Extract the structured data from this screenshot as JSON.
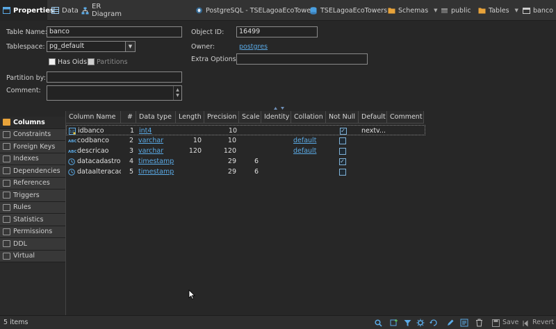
{
  "tabs": [
    {
      "label": "Properties",
      "icon": "properties-icon",
      "active": true
    },
    {
      "label": "Data",
      "icon": "data-grid-icon",
      "active": false
    },
    {
      "label": "ER Diagram",
      "icon": "er-diagram-icon",
      "active": false
    }
  ],
  "breadcrumb": {
    "connection": "PostgreSQL - TSELagoaEcoTowers",
    "database": "TSELagoaEcoTowers",
    "schemas": "Schemas",
    "schema": "public",
    "tables": "Tables",
    "table": "banco"
  },
  "form": {
    "table_name_label": "Table Name:",
    "table_name_value": "banco",
    "tablespace_label": "Tablespace:",
    "tablespace_value": "pg_default",
    "has_oids_label": "Has Oids",
    "partitions_label": "Partitions",
    "object_id_label": "Object ID:",
    "object_id_value": "16499",
    "owner_label": "Owner:",
    "owner_value": "postgres",
    "extra_options_label": "Extra Options:",
    "extra_options_value": "",
    "partition_by_label": "Partition by:",
    "partition_by_value": "",
    "comment_label": "Comment:",
    "comment_value": ""
  },
  "nav": {
    "items": [
      {
        "label": "Columns",
        "icon": "columns-icon",
        "active": true
      },
      {
        "label": "Constraints",
        "icon": "constraints-icon"
      },
      {
        "label": "Foreign Keys",
        "icon": "foreign-keys-icon"
      },
      {
        "label": "Indexes",
        "icon": "indexes-icon"
      },
      {
        "label": "Dependencies",
        "icon": "dependencies-icon"
      },
      {
        "label": "References",
        "icon": "references-icon"
      },
      {
        "label": "Triggers",
        "icon": "triggers-icon"
      },
      {
        "label": "Rules",
        "icon": "rules-icon"
      },
      {
        "label": "Statistics",
        "icon": "statistics-icon"
      },
      {
        "label": "Permissions",
        "icon": "permissions-icon"
      },
      {
        "label": "DDL",
        "icon": "ddl-icon"
      },
      {
        "label": "Virtual",
        "icon": "virtual-icon"
      }
    ]
  },
  "grid": {
    "headers": [
      "Column Name",
      "#",
      "Data type",
      "Length",
      "Precision",
      "Scale",
      "Identity",
      "Collation",
      "Not Null",
      "Default",
      "Comment"
    ],
    "rows": [
      {
        "name": "idbanco",
        "num": "1",
        "type": "int4",
        "length": "",
        "precision": "10",
        "scale": "",
        "identity": "",
        "collation": "",
        "notnull": true,
        "default": "nextv...",
        "comment": "",
        "icon": "key-column-icon"
      },
      {
        "name": "codbanco",
        "num": "2",
        "type": "varchar",
        "length": "10",
        "precision": "10",
        "scale": "",
        "identity": "",
        "collation": "default",
        "notnull": false,
        "default": "",
        "comment": "",
        "icon": "text-column-icon"
      },
      {
        "name": "descricao",
        "num": "3",
        "type": "varchar",
        "length": "120",
        "precision": "120",
        "scale": "",
        "identity": "",
        "collation": "default",
        "notnull": false,
        "default": "",
        "comment": "",
        "icon": "text-column-icon"
      },
      {
        "name": "datacadastro",
        "num": "4",
        "type": "timestamp",
        "length": "",
        "precision": "29",
        "scale": "6",
        "identity": "",
        "collation": "",
        "notnull": true,
        "default": "",
        "comment": "",
        "icon": "datetime-column-icon"
      },
      {
        "name": "dataalteracao",
        "num": "5",
        "type": "timestamp",
        "length": "",
        "precision": "29",
        "scale": "6",
        "identity": "",
        "collation": "",
        "notnull": false,
        "default": "",
        "comment": "",
        "icon": "datetime-column-icon"
      }
    ]
  },
  "status": {
    "items_count": "5 items",
    "save_label": "Save",
    "revert_label": "Revert"
  },
  "colors": {
    "accent": "#5aaae6",
    "folder": "#e8a33a",
    "background": "#272727"
  }
}
